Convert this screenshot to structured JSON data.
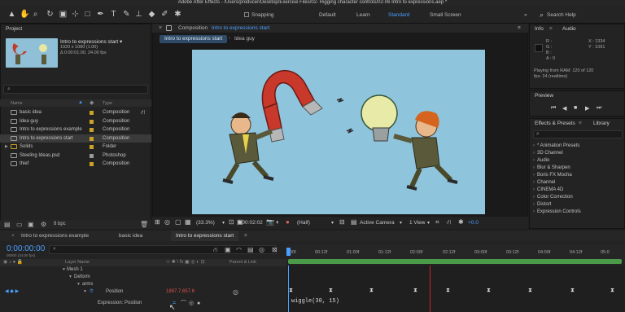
{
  "window": {
    "title": "Adobe After Effects - /Users/producer/Desktop/Exercise Files/02- Rigging character controls/02-06 Intro to expressions.aep *"
  },
  "toolbar": {
    "snapping_label": "Snapping",
    "workspaces": [
      "Default",
      "Learn",
      "Standard",
      "Small Screen"
    ],
    "search_placeholder": "Search Help"
  },
  "project": {
    "tab": "Project",
    "selected_name": "Intro to expressions start ▾",
    "selected_info1": "1920 x 1080 (1.00)",
    "selected_info2": "Δ 0:00:01:00, 24.00 fps",
    "col_name": "Name",
    "col_type": "Type",
    "items": [
      {
        "name": "basic idea",
        "type": "Composition",
        "color": "#c9a227"
      },
      {
        "name": "Idea guy",
        "type": "Composition",
        "color": "#c9a227"
      },
      {
        "name": "Intro to expressions example",
        "type": "Composition",
        "color": "#c9a227"
      },
      {
        "name": "Intro to expressions start",
        "type": "Composition",
        "color": "#c9a227"
      },
      {
        "name": "Solids",
        "type": "Folder",
        "color": "#c9a227"
      },
      {
        "name": "Steeling Ideas.psd",
        "type": "Photoshop",
        "color": "#9a9a9a"
      },
      {
        "name": "thief",
        "type": "Composition",
        "color": "#c9a227"
      }
    ],
    "footer_bpc": "8 bpc"
  },
  "composition": {
    "tab_prefix": "Composition",
    "tab_name": "Intro to expressions start",
    "subtabs": [
      "Intro to expressions start",
      "Idea guy"
    ],
    "footer": {
      "zoom": "(33.3%)",
      "timecode": "0:00:02:02",
      "resolution": "(Half)",
      "camera": "Active Camera",
      "view": "1 View",
      "exposure": "+0.0"
    }
  },
  "info": {
    "tab": "Info",
    "tab2": "Audio",
    "r": "R :",
    "g": "G :",
    "b": "B :",
    "a": "A : 0",
    "x": "X : 1334",
    "y": "Y : 1091",
    "playing": "Playing from RAM: 120 of 120",
    "fps": "fps: 24 (realtime)"
  },
  "preview": {
    "tab": "Preview"
  },
  "effects": {
    "tab": "Effects & Presets",
    "tab2": "Library",
    "items": [
      "* Animation Presets",
      "3D Channel",
      "Audio",
      "Blur & Sharpen",
      "Boris FX Mocha",
      "Channel",
      "CINEMA 4D",
      "Color Correction",
      "Distort",
      "Expression Controls"
    ]
  },
  "timeline": {
    "tabs": [
      "Intro to expressions example",
      "basic idea",
      "Intro to expressions start"
    ],
    "timecode": "0:00:00:00",
    "frame_info": "00000 (24.00 fps)",
    "header_layer": "Layer Name",
    "header_parent": "Parent & Link",
    "rows": [
      {
        "label": "Mesh 1"
      },
      {
        "label": "Deform"
      },
      {
        "label": "arms"
      },
      {
        "label": "Position",
        "value": "1897.7,657.6"
      },
      {
        "label": "Expression: Position"
      }
    ],
    "expression_text": "wiggle(30, 15)",
    "ruler_ticks": [
      "00f",
      "00:12f",
      "01:00f",
      "01:12f",
      "02:00f",
      "02:12f",
      "03:00f",
      "03:12f",
      "04:00f",
      "04:12f",
      "05:0"
    ]
  },
  "colors": {
    "accent": "#4a9fff",
    "workarea": "#4a9a4a",
    "playhead": "#cc2222",
    "keyvalue": "#d9534f"
  }
}
